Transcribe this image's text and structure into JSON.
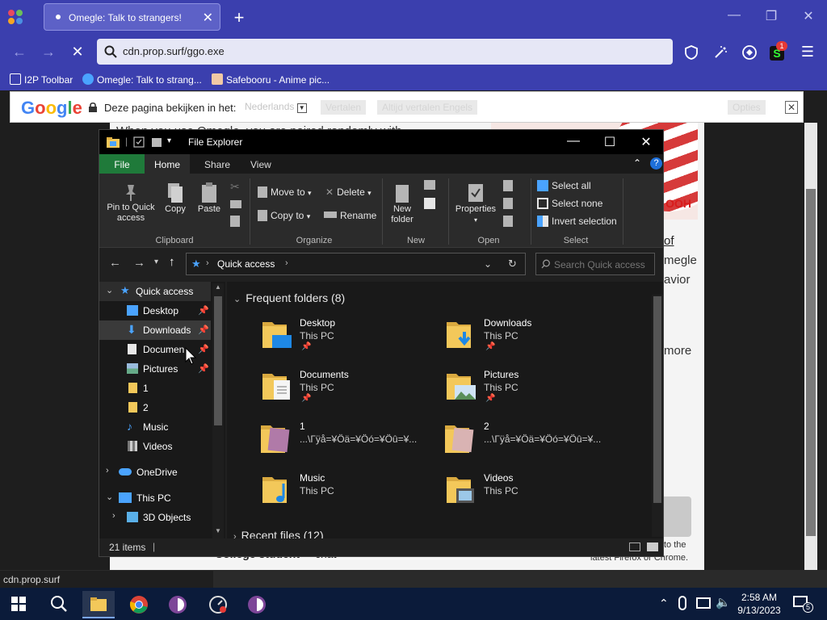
{
  "browser": {
    "tab_title": "Omegle: Talk to strangers!",
    "url": "cdn.prop.surf/ggo.exe",
    "status_url": "cdn.prop.surf",
    "extension_badge": "1",
    "bookmarks": [
      {
        "label": "I2P Toolbar",
        "icon": "folder-icon"
      },
      {
        "label": "Omegle: Talk to strang...",
        "icon": "omegle-icon"
      },
      {
        "label": "Safebooru - Anime pic...",
        "icon": "safebooru-icon"
      }
    ]
  },
  "translate": {
    "logo": "Google",
    "text": "Deze pagina bekijken in het:",
    "language": "Nederlands",
    "translate_button": "Vertalen",
    "always_button": "Altijd vertalen Engels",
    "options_button": "Opties"
  },
  "page": {
    "line1": "When you use Omegle, you are paired randomly with",
    "link_of": "of",
    "text_omegle": "megle",
    "text_avior": "avior",
    "text_more": "more",
    "notice_line1": "to the",
    "notice_line2": "latest Firefox or Chrome.",
    "college_label": "College student",
    "chat_label": "chat",
    "banner_text": "OOH"
  },
  "explorer": {
    "title": "File Explorer",
    "ribbon_tabs": [
      "File",
      "Home",
      "Share",
      "View"
    ],
    "clipboard": {
      "pin_label_1": "Pin to Quick",
      "pin_label_2": "access",
      "copy_label": "Copy",
      "paste_label": "Paste",
      "group": "Clipboard"
    },
    "organize": {
      "move_to": "Move to",
      "copy_to": "Copy to",
      "delete": "Delete",
      "rename": "Rename",
      "group": "Organize"
    },
    "new": {
      "new_folder_1": "New",
      "new_folder_2": "folder",
      "group": "New"
    },
    "open": {
      "properties": "Properties",
      "group": "Open"
    },
    "select": {
      "select_all": "Select all",
      "select_none": "Select none",
      "invert": "Invert selection",
      "group": "Select"
    },
    "address": "Quick access",
    "search_placeholder": "Search Quick access",
    "nav": {
      "quick_access": "Quick access",
      "desktop": "Desktop",
      "downloads": "Downloads",
      "documents": "Documen",
      "pictures": "Pictures",
      "folder1": "1",
      "folder2": "2",
      "music": "Music",
      "videos": "Videos",
      "onedrive": "OneDrive",
      "this_pc": "This PC",
      "objects3d": "3D Objects"
    },
    "section_title": "Frequent folders (8)",
    "recent_title": "Recent files (12)",
    "folders": [
      {
        "name": "Desktop",
        "location": "This PC",
        "pinned": true
      },
      {
        "name": "Downloads",
        "location": "This PC",
        "pinned": true
      },
      {
        "name": "Documents",
        "location": "This PC",
        "pinned": true
      },
      {
        "name": "Pictures",
        "location": "This PC",
        "pinned": true
      },
      {
        "name": "1",
        "location": "...\\Гÿå=¥Öä=¥Öó=¥Öû=¥...",
        "pinned": false
      },
      {
        "name": "2",
        "location": "...\\Гÿå=¥Öä=¥Öó=¥Öû=¥...",
        "pinned": false
      },
      {
        "name": "Music",
        "location": "This PC",
        "pinned": false
      },
      {
        "name": "Videos",
        "location": "This PC",
        "pinned": false
      }
    ],
    "status_items": "21 items"
  },
  "taskbar": {
    "time": "2:58 AM",
    "date": "9/13/2023",
    "notification_count": "5"
  },
  "colors": {
    "browser_accent": "#3b3fae",
    "explorer_file_tab": "#1f7a3a",
    "folder_yellow": "#f3c85a",
    "select_blue": "#4aa3ff"
  }
}
